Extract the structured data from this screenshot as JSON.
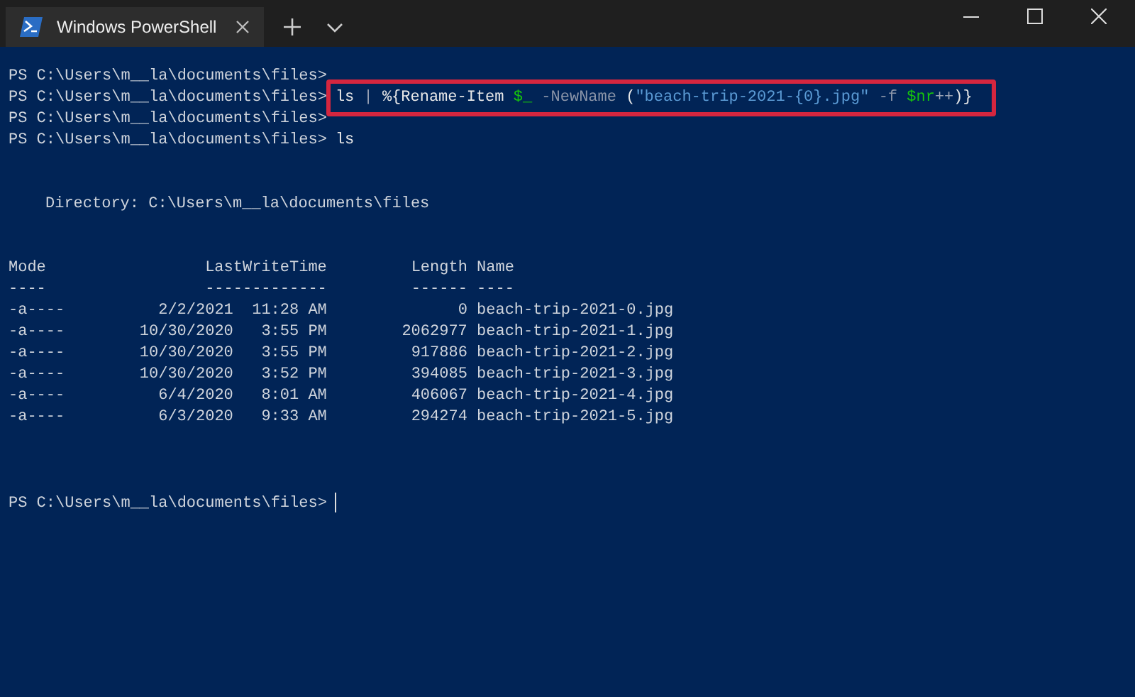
{
  "window": {
    "tab_title": "Windows PowerShell"
  },
  "terminal": {
    "prompts": [
      {
        "prompt": "PS C:\\Users\\m__la\\documents\\files>",
        "highlighted": false
      },
      {
        "prompt": "PS C:\\Users\\m__la\\documents\\files>",
        "highlighted": true,
        "command": [
          {
            "text": "ls",
            "kind": "command"
          },
          {
            "text": " |",
            "kind": "operator"
          },
          {
            "text": " %{Rename-Item",
            "kind": "command"
          },
          {
            "text": " $_",
            "kind": "variable"
          },
          {
            "text": " -NewName",
            "kind": "parameter"
          },
          {
            "text": " (",
            "kind": "plain"
          },
          {
            "text": "\"beach-trip-2021-{0}.jpg\"",
            "kind": "string"
          },
          {
            "text": " -f",
            "kind": "parameter"
          },
          {
            "text": " $nr",
            "kind": "variable"
          },
          {
            "text": "++",
            "kind": "operator"
          },
          {
            "text": ")}",
            "kind": "plain"
          }
        ]
      },
      {
        "prompt": "PS C:\\Users\\m__la\\documents\\files>",
        "highlighted": false
      },
      {
        "prompt": "PS C:\\Users\\m__la\\documents\\files>",
        "highlighted": false,
        "command": [
          {
            "text": "ls",
            "kind": "command"
          }
        ]
      }
    ],
    "directory": "Directory: C:\\Users\\m__la\\documents\\files",
    "columns": {
      "mode": "Mode",
      "time": "LastWriteTime",
      "length": "Length",
      "name": "Name"
    },
    "underlines": {
      "mode": "----",
      "time": "-------------",
      "length": "------",
      "name": "----"
    },
    "rows": [
      {
        "mode": "-a----",
        "date": "2/2/2021",
        "time": "11:28 AM",
        "length": "0",
        "name": "beach-trip-2021-0.jpg"
      },
      {
        "mode": "-a----",
        "date": "10/30/2020",
        "time": "3:55 PM",
        "length": "2062977",
        "name": "beach-trip-2021-1.jpg"
      },
      {
        "mode": "-a----",
        "date": "10/30/2020",
        "time": "3:55 PM",
        "length": "917886",
        "name": "beach-trip-2021-2.jpg"
      },
      {
        "mode": "-a----",
        "date": "10/30/2020",
        "time": "3:52 PM",
        "length": "394085",
        "name": "beach-trip-2021-3.jpg"
      },
      {
        "mode": "-a----",
        "date": "6/4/2020",
        "time": "8:01 AM",
        "length": "406067",
        "name": "beach-trip-2021-4.jpg"
      },
      {
        "mode": "-a----",
        "date": "6/3/2020",
        "time": "9:33 AM",
        "length": "294274",
        "name": "beach-trip-2021-5.jpg"
      }
    ],
    "final_prompt": "PS C:\\Users\\m__la\\documents\\files>"
  }
}
